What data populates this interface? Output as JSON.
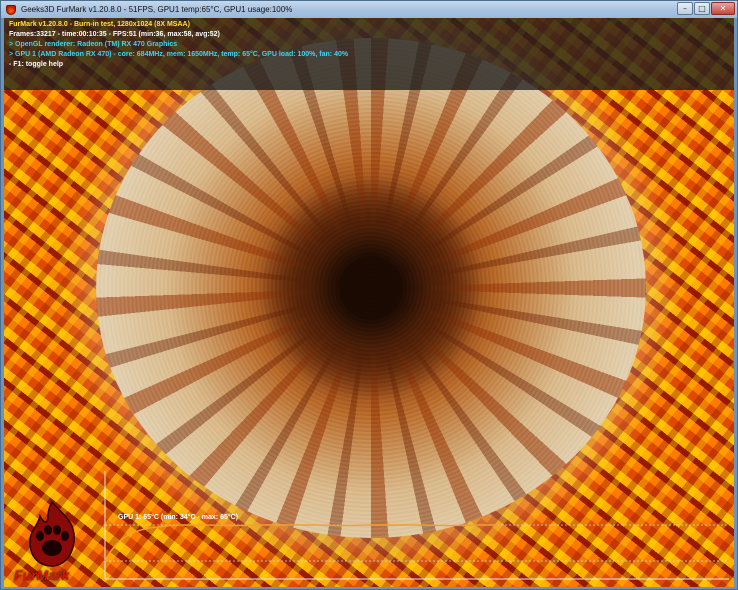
{
  "window": {
    "title": "Geeks3D FurMark v1.20.8.0 - 51FPS, GPU1 temp:65°C, GPU1 usage:100%",
    "controls": {
      "minimize": "–",
      "maximize": "□",
      "close": "✕"
    }
  },
  "hud": {
    "line1": "FurMark v1.20.8.0 - Burn-in test, 1280x1024 (8X MSAA)",
    "line2": "Frames:33217 - time:00:10:35 - FPS:51 (min:36, max:58, avg:52)",
    "line3": "> OpenGL renderer: Radeon (TM) RX 470 Graphics",
    "line4": "> GPU 1 (AMD Radeon RX 470) - core: 684MHz, mem: 1650MHz, temp: 65°C, GPU load: 100%, fan: 40%",
    "line5": "- F1: toggle help",
    "colors": {
      "yellow": "#ffe23a",
      "white": "#ffffff",
      "cyan": "#3fd4f0"
    }
  },
  "temp_graph": {
    "label": "GPU 1: 65°C (min: 34°C - max: 65°C)",
    "line_color": "#f0a030",
    "min_temp": 34,
    "max_temp": 65,
    "current_temp": 65
  },
  "logo": {
    "text": "FurMark",
    "icon": "flame-paw-logo-icon",
    "color": "#e01010"
  }
}
